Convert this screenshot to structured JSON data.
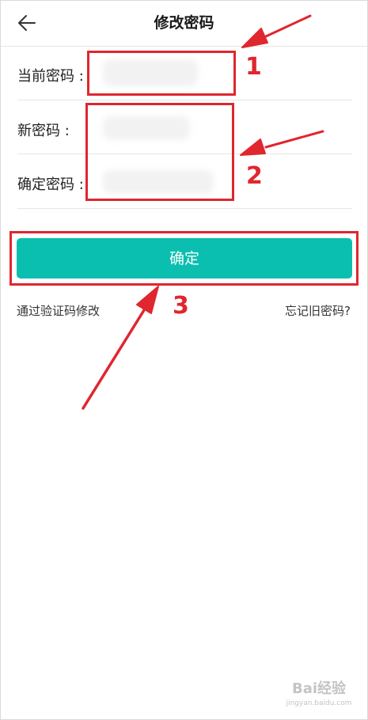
{
  "header": {
    "title": "修改密码",
    "back_icon": "arrow-left-icon"
  },
  "form": {
    "fields": [
      {
        "label": "当前密码 :",
        "value": ""
      },
      {
        "label": "新密码 :",
        "value": ""
      },
      {
        "label": "确定密码 :",
        "value": ""
      }
    ]
  },
  "actions": {
    "confirm_label": "确定"
  },
  "links": {
    "verify_code": "通过验证码修改",
    "forgot_password": "忘记旧密码?"
  },
  "annotations": {
    "markers": [
      "1",
      "2",
      "3"
    ],
    "color": "#e0262e"
  },
  "theme": {
    "accent": "#0bbfb0"
  },
  "watermark": {
    "logo": "Bai经验",
    "url": "jingyan.baidu.com"
  }
}
